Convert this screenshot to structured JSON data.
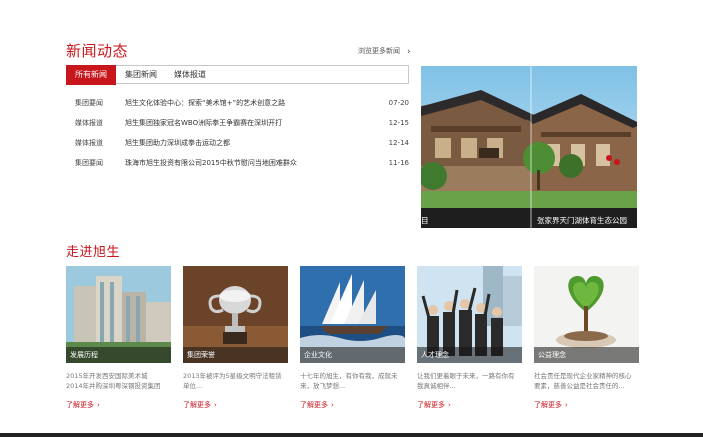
{
  "news": {
    "title": "新闻动态",
    "more_label": "浏览更多新闻",
    "tabs": [
      {
        "label": "所有新闻",
        "active": true
      },
      {
        "label": "集团新闻",
        "active": false
      },
      {
        "label": "媒体报道",
        "active": false
      }
    ],
    "items": [
      {
        "category": "集团要闻",
        "title": "旭生文化体验中心：探索“美术馆+”的艺术创意之路",
        "date": "07-20"
      },
      {
        "category": "媒体报道",
        "title": "旭生集团独家冠名WBO洲际拳王争霸赛在深圳开打",
        "date": "12-15"
      },
      {
        "category": "媒体报道",
        "title": "旭生集团助力深圳成拳击运动之都",
        "date": "12-14"
      },
      {
        "category": "集团要闻",
        "title": "珠海市旭生投资有限公司2015中秋节慰问当地困难群众",
        "date": "11-16"
      }
    ],
    "photo_captions": [
      "目",
      "张家界天门湖体育生态公园"
    ]
  },
  "intro": {
    "title": "走进旭生",
    "cards": [
      {
        "label": "发展历程",
        "desc": [
          "2015年开发西安国际美术城",
          "2014年并购深圳粤深钢投资集团"
        ],
        "link": "了解更多"
      },
      {
        "label": "集团荣誉",
        "desc": [
          "2013年被评为5星级文明守法租赁",
          "单位..."
        ],
        "link": "了解更多"
      },
      {
        "label": "企业文化",
        "desc": [
          "十七年的旭生，有你有我，成就未",
          "来，放飞梦想..."
        ],
        "link": "了解更多"
      },
      {
        "label": "人才理念",
        "desc": [
          "让我们更着眼于未来，一路有你有",
          "我真诚相伴..."
        ],
        "link": "了解更多"
      },
      {
        "label": "公益理念",
        "desc": [
          "社会责任是现代企业家精神的核心",
          "要素，慈善公益是社会责任的..."
        ],
        "link": "了解更多"
      }
    ]
  },
  "colors": {
    "accent": "#c8161d",
    "text": "#333333",
    "muted": "#777777"
  },
  "icons": {
    "more": "chevron-right-icon",
    "link": "chevron-right-icon"
  }
}
